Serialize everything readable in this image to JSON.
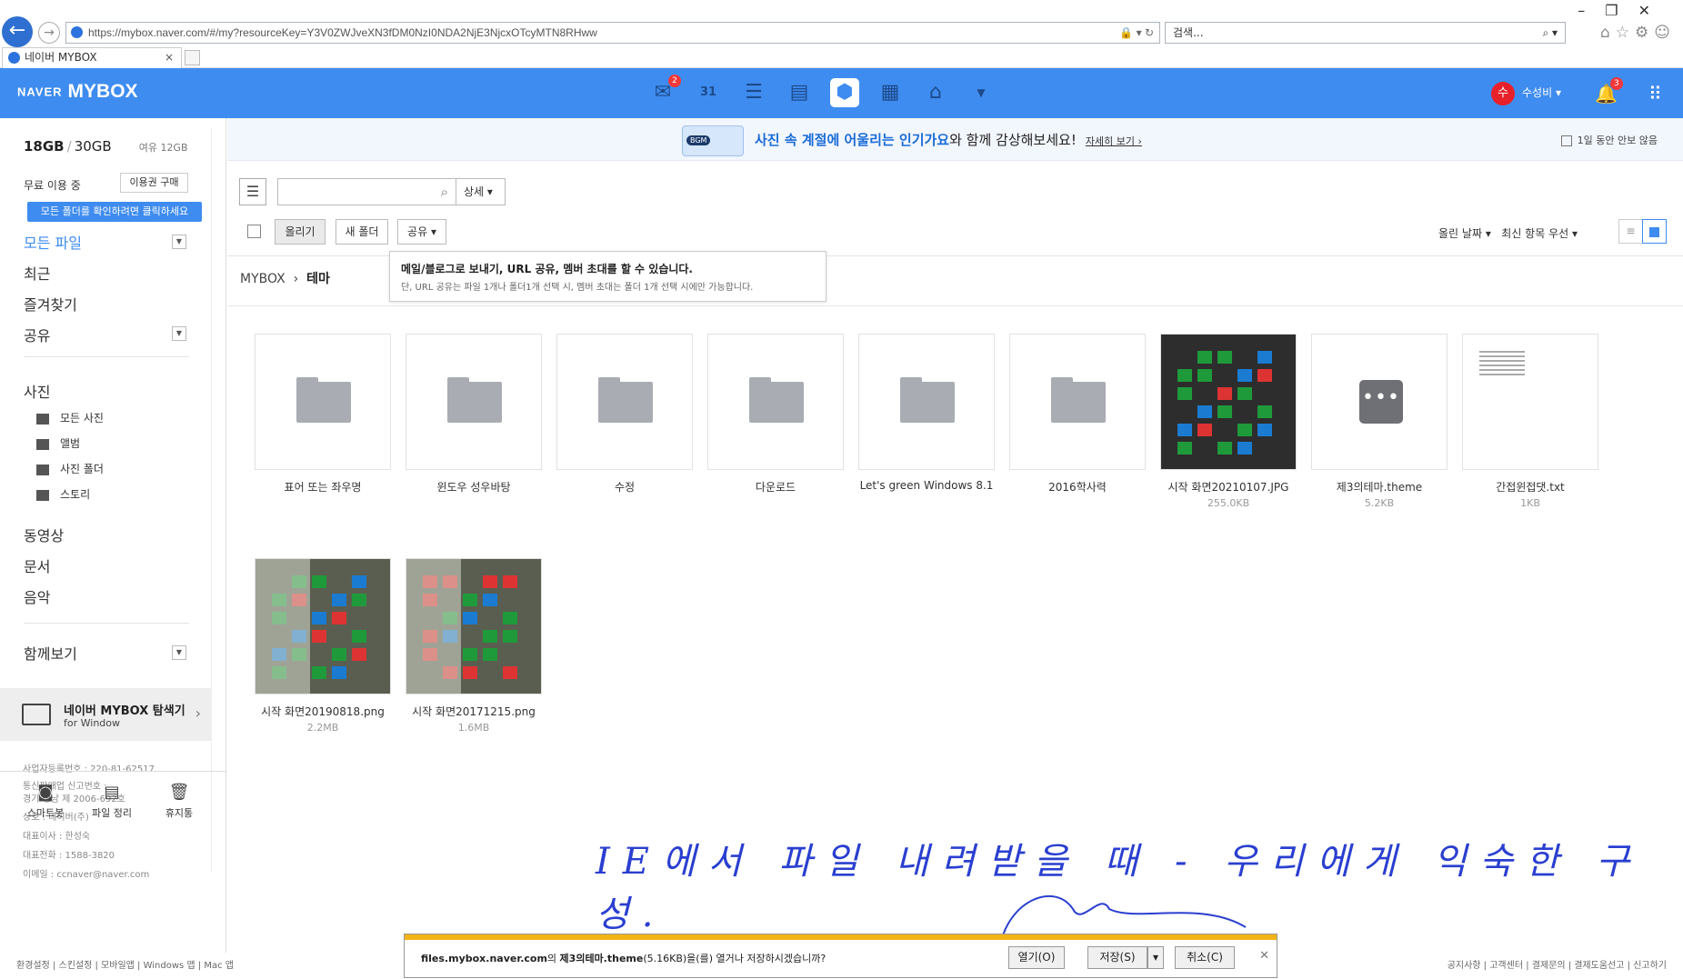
{
  "browser": {
    "url": "https://mybox.naver.com/#/my?resourceKey=Y3V0ZWJveXN3fDM0NzI0NDA2NjE3NjcxOTcyMTN8RHww",
    "search_placeholder": "검색...",
    "tab_title": "네이버 MYBOX",
    "tab_close": "×"
  },
  "header": {
    "brand_naver": "NAVER",
    "brand_mybox": "MYBOX",
    "mail_badge": "2",
    "calendar_day": "31",
    "user_initial": "수",
    "user_name": "수성비",
    "notif_badge": "3"
  },
  "sidebar": {
    "used": "18GB",
    "total": "30GB",
    "free": "여유 12GB",
    "plan": "무료 이용 중",
    "buy_label": "이용권 구매",
    "tip": "모든 폴더를 확인하려면 클릭하세요",
    "nav": {
      "all": "모든 파일",
      "recent": "최근",
      "fav": "즐겨찾기",
      "share": "공유",
      "photo": "사진",
      "video": "동영상",
      "doc": "문서",
      "music": "음악",
      "together": "함께보기"
    },
    "photo_sub": [
      "모든 사진",
      "앨범",
      "사진 폴더",
      "스토리"
    ],
    "explorer_title": "네이버 MYBOX 탐색기",
    "explorer_sub": "for Window",
    "corp": [
      "사업자등록번호 : 220-81-62517",
      "통신판매업 신고번호 :",
      "경기 성남 제 2006-692호",
      "상호 : 네이버(주)",
      "대표이사 : 한성숙",
      "대표전화 : 1588-3820",
      "이메일 : ccnaver@naver.com"
    ],
    "bottom": [
      "스마트봇",
      "파일 정리",
      "휴지통"
    ],
    "footer_links": "환경설정 | 스킨설정 | 모바일앱 | Windows 앱 | Mac 앱"
  },
  "footer_right": "공지사항 | 고객센터 | 결제문의 | 결제도움선고 | 신고하기",
  "banner": {
    "bgm": "BGM",
    "text_highlight": "사진 속 계절에 어울리는 인기가요",
    "text_rest": "와 함께 감상해보세요!",
    "more": "자세히 보기",
    "oneday": "1일 동안 안보 않음"
  },
  "toolbar": {
    "detail": "상세",
    "upload": "올리기",
    "new_folder": "새 폴더",
    "share": "공유",
    "sort_date": "올린 날짜",
    "sort_recent": "최신 항목 우선"
  },
  "tooltip": {
    "line1": "메일/블로그로 보내기, URL 공유, 멤버 초대를 할 수 있습니다.",
    "line2": "단, URL 공유는 파일 1개나 폴더1개 선택 시, 멤버 초대는 폴더 1개 선택 시에만 가능합니다."
  },
  "breadcrumb": {
    "root": "MYBOX",
    "current": "테마"
  },
  "files": [
    {
      "name": "표어 또는 좌우명",
      "size": "",
      "kind": "folder"
    },
    {
      "name": "윈도우 성우바탕",
      "size": "",
      "kind": "folder"
    },
    {
      "name": "수정",
      "size": "",
      "kind": "folder"
    },
    {
      "name": "다운로드",
      "size": "",
      "kind": "folder"
    },
    {
      "name": "Let's green Windows 8.1",
      "size": "",
      "kind": "folder"
    },
    {
      "name": "2016학사력",
      "size": "",
      "kind": "folder"
    },
    {
      "name": "시작 화면20210107.JPG",
      "size": "255.0KB",
      "kind": "image"
    },
    {
      "name": "제3의테마.theme",
      "size": "5.2KB",
      "kind": "theme"
    },
    {
      "name": "간접윈접댓.txt",
      "size": "1KB",
      "kind": "txt"
    },
    {
      "name": "시작 화면20190818.png",
      "size": "2.2MB",
      "kind": "image"
    },
    {
      "name": "시작 화면20171215.png",
      "size": "1.6MB",
      "kind": "image"
    }
  ],
  "annotation": "IE에서 파일 내려받을 때 - 우리에게 익숙한 구성.",
  "download_bar": {
    "host": "files.mybox.naver.com",
    "mid": "의 ",
    "file": "제3의테마.theme",
    "rest": "(5.16KB)을(를) 열거나 저장하시겠습니까?",
    "open": "열기(O)",
    "save": "저장(S)",
    "cancel": "취소(C)"
  },
  "colors": {
    "brand_blue": "#3f8cf0",
    "annotation_blue": "#2a3fd0",
    "download_strip": "#f2b317"
  }
}
